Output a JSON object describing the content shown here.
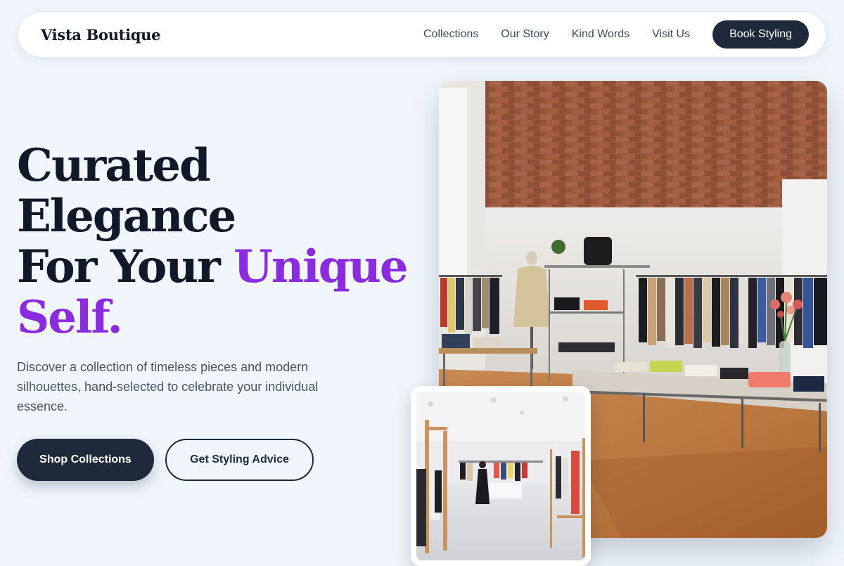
{
  "brand": {
    "name": "Vista Boutique"
  },
  "nav": {
    "links": [
      "Collections",
      "Our Story",
      "Kind Words",
      "Visit Us"
    ],
    "cta": "Book Styling"
  },
  "hero": {
    "title_line1": "Curated",
    "title_line2": "Elegance",
    "title_line3_plain": "For Your ",
    "title_line3_accent": "Unique",
    "title_line4_accent": "Self.",
    "description": "Discover a collection of timeless pieces and modern silhouettes, hand-selected to celebrate your individual essence.",
    "primary_button": "Shop Collections",
    "secondary_button": "Get Styling Advice"
  },
  "colors": {
    "page_background": "#f0f6fc",
    "primary_dark": "#1e293b",
    "accent_purple": "#8a2be2",
    "heading_text": "#111827",
    "body_text": "#4a5363"
  },
  "images": {
    "main_photo": "boutique-interior-photo",
    "inset_photo": "store-floor-photo"
  }
}
